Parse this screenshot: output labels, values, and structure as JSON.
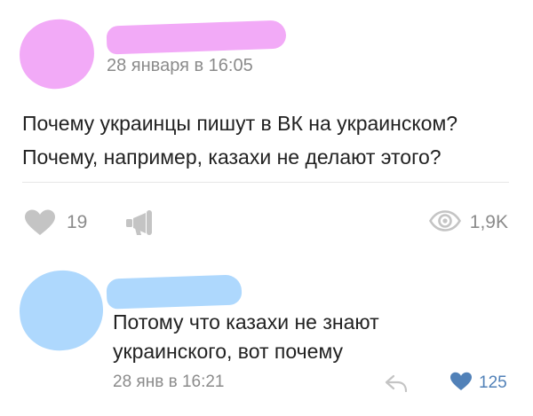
{
  "post": {
    "date": "28 января в 16:05",
    "text_lines": [
      "Почему украинцы пишут в ВК на украинском?",
      "Почему, например, казахи не делают этого?"
    ],
    "likes": "19",
    "views": "1,9K",
    "avatar_color": "#f2aaf7"
  },
  "comment": {
    "text_lines": [
      "Потому что казахи не знают",
      "украинского, вот почему"
    ],
    "date": "28 янв в 16:21",
    "likes": "125",
    "avatar_color": "#aed8fd",
    "like_color": "#5181b8"
  },
  "icons": {
    "like": "heart-icon",
    "share": "megaphone-icon",
    "views": "eye-icon",
    "reply": "reply-arrow-icon",
    "comment_like": "heart-icon"
  }
}
